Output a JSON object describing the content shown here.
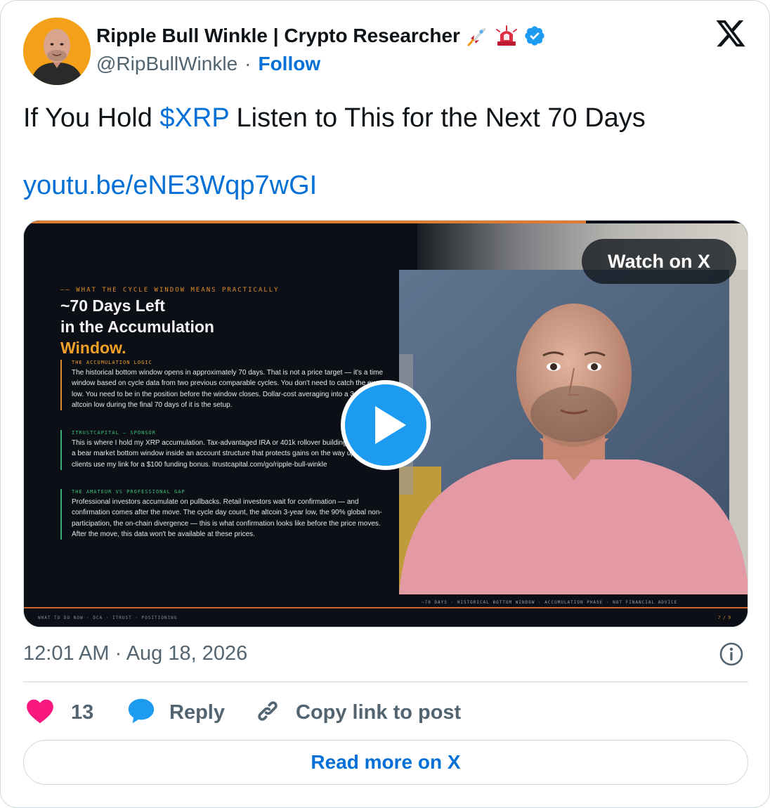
{
  "author": {
    "name": "Ripple Bull Winkle | Crypto Researcher",
    "name_emojis": [
      "rocket-emoji",
      "rotating-light-emoji"
    ],
    "verified": true,
    "handle": "@RipBullWinkle",
    "separator": "·",
    "follow_label": "Follow"
  },
  "tweet": {
    "text_before": "If You Hold ",
    "cashtag": "$XRP",
    "text_after": " Listen to This for the Next 70 Days",
    "link": "youtu.be/eNE3Wqp7wGI"
  },
  "media": {
    "watch_label": "Watch on X",
    "slide": {
      "kicker": "—— WHAT THE CYCLE WINDOW MEANS PRACTICALLY",
      "title_line1": "~70 Days Left",
      "title_line2": "in the Accumulation",
      "title_accent": "Window.",
      "blocks": [
        {
          "label": "THE ACCUMULATION LOGIC",
          "body": "The historical bottom window opens in approximately 70 days. That is not a price target — it's a time window based on cycle data from two previous comparable cycles. You don't need to catch the exact low. You need to be in the position before the window closes. Dollar-cost averaging into a 3-year altcoin low during the final 70 days of it is the setup."
        },
        {
          "label": "ITRUSTCAPITAL — SPONSOR",
          "body": "This is where I hold my XRP accumulation. Tax-advantaged IRA or 401k rollover building a position in a bear market bottom window inside an account structure that protects gains on the way up. New clients use my link for a $100 funding bonus. itrustcapital.com/go/ripple-bull-winkle"
        },
        {
          "label": "THE AMATEUR VS PROFESSIONAL GAP",
          "body": "Professional investors accumulate on pullbacks. Retail investors wait for confirmation — and confirmation comes after the move. The cycle day count, the altcoin 3-year low, the 90% global non-participation, the on-chain divergence — this is what confirmation looks like before the price moves. After the move, this data won't be available at these prices."
        }
      ],
      "footer": "WHAT TO DO NOW · DCA · ITRUST · POSITIONING",
      "ticker": "~70 DAYS · HISTORICAL BOTTOM WINDOW · ACCUMULATION PHASE · NOT FINANCIAL ADVICE",
      "pager": "7 / 9"
    }
  },
  "meta": {
    "time": "12:01 AM",
    "separator": "·",
    "date": "Aug 18, 2026",
    "timestamp_full": "12:01 AM · Aug 18, 2026"
  },
  "actions": {
    "like_count": "13",
    "reply_label": "Reply",
    "copy_label": "Copy link to post"
  },
  "read_more_label": "Read more on X",
  "colors": {
    "link_blue": "#006fd6",
    "like_pink": "#f91880",
    "reply_blue": "#1d9bf0",
    "slide_accent": "#f0a028",
    "muted": "#536471"
  }
}
